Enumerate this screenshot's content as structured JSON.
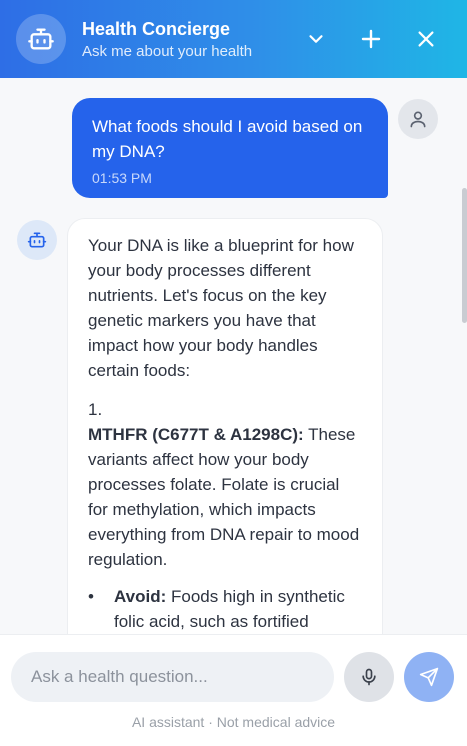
{
  "header": {
    "title": "Health Concierge",
    "subtitle": "Ask me about your health",
    "icons": {
      "avatar": "robot-icon",
      "collapse": "chevron-down-icon",
      "new": "plus-icon",
      "close": "close-icon"
    }
  },
  "messages": {
    "user": {
      "text": "What foods should I avoid based on my DNA?",
      "time": "01:53 PM",
      "avatar_icon": "user-icon"
    },
    "assistant": {
      "avatar_icon": "robot-icon",
      "intro": "Your DNA is like a blueprint for how your body processes different nutrients. Let's focus on the key genetic markers you have that impact how your body handles certain foods:",
      "item_number": "1.",
      "item_title": "MTHFR (C677T & A1298C):",
      "item_text": " These variants affect how your body processes folate. Folate is crucial for methylation, which impacts everything from DNA repair to mood regulation.",
      "bullet_label": "Avoid:",
      "bullet_text": " Foods high in synthetic folic acid, such as fortified cereals and processed grains."
    }
  },
  "composer": {
    "placeholder": "Ask a health question...",
    "mic_icon": "microphone-icon",
    "send_icon": "send-icon",
    "disclaimer": "AI assistant · Not medical advice"
  },
  "colors": {
    "header_gradient_start": "#2e6ee6",
    "header_gradient_end": "#1fb6e6",
    "user_bubble": "#2563eb",
    "send_button": "#8fb2f4"
  }
}
